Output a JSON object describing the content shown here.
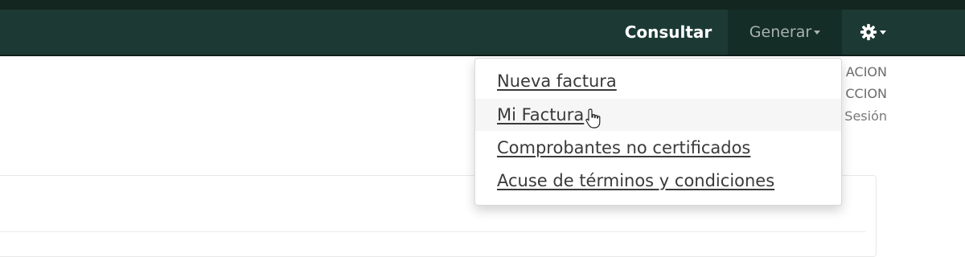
{
  "navbar": {
    "consultar_label": "Consultar",
    "generar_label": "Generar",
    "settings_icon": "gear-icon",
    "bg_color": "#1c3a33",
    "active_bg_color": "#142d27"
  },
  "side_info": {
    "line1": "ACION",
    "line2": "CCION",
    "line3": "Sesión"
  },
  "dropdown": {
    "items": [
      {
        "label": "Nueva factura"
      },
      {
        "label": "Mi Factura"
      },
      {
        "label": "Comprobantes no certificados"
      },
      {
        "label": "Acuse de términos y condiciones"
      }
    ]
  }
}
